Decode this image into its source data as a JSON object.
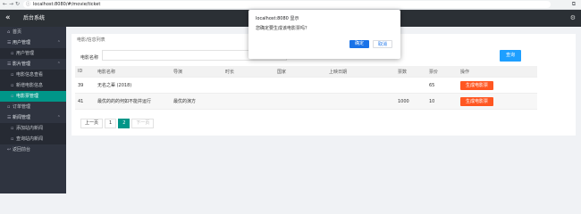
{
  "browser": {
    "back": "←",
    "forward": "→",
    "reload": "↻",
    "url": "localhost:8080/#/movie/ticket"
  },
  "header": {
    "title": "后台系统",
    "collapse_glyph": "«"
  },
  "sidebar": {
    "items": [
      {
        "label": "首页",
        "type": "top"
      },
      {
        "label": "用户管理",
        "type": "group"
      },
      {
        "label": "用户管理",
        "type": "sub"
      },
      {
        "label": "影片管理",
        "type": "group"
      },
      {
        "label": "电影信息查看",
        "type": "sub"
      },
      {
        "label": "新增电影信息",
        "type": "sub"
      },
      {
        "label": "电影票管理",
        "type": "sub",
        "active": true
      },
      {
        "label": "订单管理",
        "type": "top"
      },
      {
        "label": "新闻管理",
        "type": "group"
      },
      {
        "label": "添加站内新闻",
        "type": "sub"
      },
      {
        "label": "查询站内新闻",
        "type": "sub"
      },
      {
        "label": "返回前台",
        "type": "top"
      }
    ]
  },
  "content": {
    "breadcrumb": "电影/信息列表",
    "filter_label": "电影名称",
    "search_label": "查询",
    "table": {
      "headers": [
        "ID",
        "电影名称",
        "导演",
        "时长",
        "国家",
        "上映日期",
        "票数",
        "票价",
        "操作"
      ],
      "rows": [
        [
          "39",
          "无名之辈 (2018)",
          "",
          "",
          "",
          "",
          "",
          "65",
          "生成电影票"
        ],
        [
          "41",
          "最优的的的何如不能并运行",
          "最优的演方",
          "",
          "",
          "",
          "1000",
          "10",
          "生成电影票"
        ]
      ]
    },
    "pager": {
      "prev": "上一页",
      "pages": [
        "1",
        "2"
      ],
      "current": "2",
      "next": "下一页"
    }
  },
  "dialog": {
    "title": "localhost:8080 显示",
    "message": "您确定要生成该电影票吗？",
    "ok_label": "确定",
    "cancel_label": "取消"
  },
  "colors": {
    "accent": "#009688",
    "danger": "#ff5722",
    "primary": "#1e9fff",
    "header": "#2b3035",
    "sidebar": "#2f3440"
  }
}
